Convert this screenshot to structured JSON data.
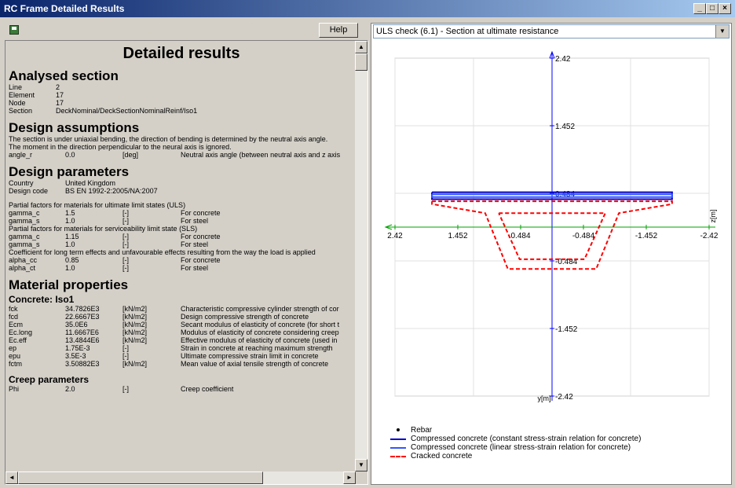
{
  "window": {
    "title": "RC Frame Detailed Results"
  },
  "toolbar": {
    "help_label": "Help"
  },
  "dropdown": {
    "selected": "ULS check (6.1) - Section at ultimate resistance"
  },
  "doc": {
    "title": "Detailed results",
    "analysed_section": {
      "heading": "Analysed section",
      "rows": [
        {
          "k": "Line",
          "v": "2"
        },
        {
          "k": "Element",
          "v": "17"
        },
        {
          "k": "Node",
          "v": "17"
        },
        {
          "k": "Section",
          "v": "DeckNominal/DeckSectionNominalReinf/Iso1"
        }
      ]
    },
    "design_assumptions": {
      "heading": "Design assumptions",
      "line1": "The section is under uniaxial bending, the direction of bending is determined by the neutral axis angle.",
      "line2": "The moment in the direction perpendicular to the neural axis is ignored.",
      "row": {
        "k": "angle_r",
        "v": "0.0",
        "u": "[deg]",
        "d": "Neutral axis angle (between neutral axis and z axis"
      }
    },
    "design_parameters": {
      "heading": "Design parameters",
      "country_k": "Country",
      "country_v": "United Kingdom",
      "code_k": "Design code",
      "code_v": "BS EN 1992-2:2005/NA:2007",
      "uls_title": "Partial factors for materials for ultimate limit states (ULS)",
      "uls_rows": [
        {
          "k": "gamma_c",
          "v": "1.5",
          "u": "[-]",
          "d": "For concrete"
        },
        {
          "k": "gamma_s",
          "v": "1.0",
          "u": "[-]",
          "d": "For steel"
        }
      ],
      "sls_title": "Partial factors for materials for serviceability limit state (SLS)",
      "sls_rows": [
        {
          "k": "gamma_c",
          "v": "1.15",
          "u": "[-]",
          "d": "For concrete"
        },
        {
          "k": "gamma_s",
          "v": "1.0",
          "u": "[-]",
          "d": "For steel"
        }
      ],
      "coef_title": "Coefficient for long term effects and unfavourable effects resulting from the way the load is applied",
      "coef_rows": [
        {
          "k": "alpha_cc",
          "v": "0.85",
          "u": "[-]",
          "d": "For concrete"
        },
        {
          "k": "alpha_ct",
          "v": "1.0",
          "u": "[-]",
          "d": "For steel"
        }
      ]
    },
    "material_properties": {
      "heading": "Material properties",
      "concrete_heading": "Concrete: Iso1",
      "rows": [
        {
          "k": "fck",
          "v": "34.7826E3",
          "u": "[kN/m2]",
          "d": "Characteristic compressive cylinder strength of cor"
        },
        {
          "k": "fcd",
          "v": "22.6667E3",
          "u": "[kN/m2]",
          "d": "Design compressive strength of concrete"
        },
        {
          "k": "Ecm",
          "v": "35.0E6",
          "u": "[kN/m2]",
          "d": "Secant modulus of elasticity of concrete (for short t"
        },
        {
          "k": "Ec.long",
          "v": "11.6667E6",
          "u": "[kN/m2]",
          "d": "Modulus of elasticity of concrete considering creep"
        },
        {
          "k": "Ec.eff",
          "v": "13.4844E6",
          "u": "[kN/m2]",
          "d": "Effective modulus of elasticity of concrete (used in"
        },
        {
          "k": "ep",
          "v": "1.75E-3",
          "u": "[-]",
          "d": "Strain in concrete at reaching maximum strength"
        },
        {
          "k": "epu",
          "v": "3.5E-3",
          "u": "[-]",
          "d": "Ultimate compressive strain limit in concrete"
        },
        {
          "k": "fctm",
          "v": "3.50882E3",
          "u": "[kN/m2]",
          "d": "Mean value of axial tensile strength of concrete"
        }
      ],
      "creep_heading": "Creep parameters",
      "creep_rows": [
        {
          "k": "Phi",
          "v": "2.0",
          "u": "[-]",
          "d": "Creep coefficient"
        }
      ]
    }
  },
  "chart_data": {
    "type": "line",
    "xlim": [
      2.42,
      -2.42
    ],
    "ylim": [
      -2.42,
      2.42
    ],
    "x_ticks": [
      "2.42",
      "1.452",
      "0.484",
      "-0.484",
      "-1.452",
      "-2.42"
    ],
    "x_tick_values": [
      2.42,
      1.452,
      0.484,
      -0.484,
      -1.452,
      -2.42
    ],
    "y_ticks": [
      "2.42",
      "1.452",
      "0.484",
      "-0.484",
      "-1.452",
      "-2.42"
    ],
    "y_tick_values": [
      2.42,
      1.452,
      0.484,
      -0.484,
      -1.452,
      -2.42
    ],
    "xlabel": "z[m]",
    "ylabel": "y[m]",
    "grid": true,
    "legend_placement": "bottom",
    "legend": [
      {
        "label": "Rebar",
        "style": "dot",
        "color": "#000000"
      },
      {
        "label": "Compressed concrete (constant stress-strain relation for concrete)",
        "style": "solid",
        "color": "#0000cc"
      },
      {
        "label": "Compressed concrete (linear stress-strain relation for concrete)",
        "style": "solid",
        "color": "#3355ff"
      },
      {
        "label": "Cracked concrete",
        "style": "dashed",
        "color": "#ff0000"
      }
    ],
    "series": [
      {
        "name": "Compressed concrete (constant stress-strain relation for concrete)",
        "color": "#0000cc",
        "points": [
          [
            1.85,
            0.5
          ],
          [
            -1.85,
            0.5
          ],
          [
            -1.85,
            0.4
          ],
          [
            1.85,
            0.4
          ],
          [
            1.85,
            0.5
          ]
        ]
      },
      {
        "name": "Compressed concrete (linear stress-strain relation for concrete)",
        "color": "#3355ff",
        "points": [
          [
            1.85,
            0.47
          ],
          [
            -1.85,
            0.47
          ],
          [
            -1.85,
            0.43
          ],
          [
            1.85,
            0.43
          ],
          [
            1.85,
            0.47
          ]
        ]
      },
      {
        "name": "Cracked concrete",
        "color": "#ff0000",
        "points": [
          [
            1.85,
            0.37
          ],
          [
            -1.85,
            0.37
          ],
          [
            -1.85,
            0.33
          ],
          [
            -1.03,
            0.2
          ],
          [
            -0.68,
            -0.6
          ],
          [
            0.68,
            -0.6
          ],
          [
            1.03,
            0.2
          ],
          [
            1.85,
            0.33
          ],
          [
            1.85,
            0.37
          ]
        ]
      },
      {
        "name": "Cracked concrete",
        "color": "#ff0000",
        "points": [
          [
            0.82,
            0.2
          ],
          [
            -0.82,
            0.2
          ],
          [
            -0.5,
            -0.46
          ],
          [
            0.5,
            -0.46
          ],
          [
            0.82,
            0.2
          ]
        ]
      }
    ]
  }
}
